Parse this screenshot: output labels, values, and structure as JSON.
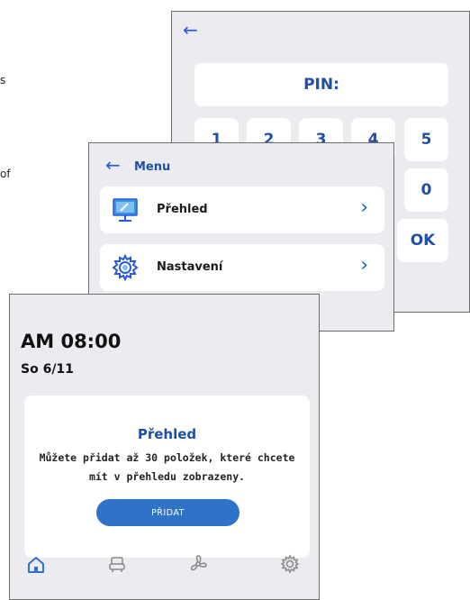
{
  "pin_screen": {
    "back_icon": "arrow-left-icon",
    "pin_label": "PIN:",
    "keys": [
      "1",
      "2",
      "3",
      "4",
      "5",
      "0"
    ],
    "ok_label": "OK"
  },
  "menu_screen": {
    "back_icon": "arrow-left-icon",
    "title": "Menu",
    "items": [
      {
        "label": "Přehled",
        "icon": "monitor-icon",
        "chevron": "chevron-right-icon"
      },
      {
        "label": "Nastavení",
        "icon": "gear-icon",
        "chevron": "chevron-right-icon"
      }
    ]
  },
  "home_screen": {
    "time": "AM 08:00",
    "date": "So 6/11",
    "card": {
      "title": "Přehled",
      "description": "Můžete přidat až 30 položek, které chcete mít v přehledu zobrazeny.",
      "button_label": "PŘIDAT"
    },
    "bottom_nav": [
      "home-icon",
      "armchair-icon",
      "fan-icon",
      "settings-icon"
    ]
  },
  "colors": {
    "accent": "#2f73c9",
    "text_accent": "#1f4fa8",
    "panel_bg": "#ecebf0",
    "card_bg": "#ffffff"
  }
}
